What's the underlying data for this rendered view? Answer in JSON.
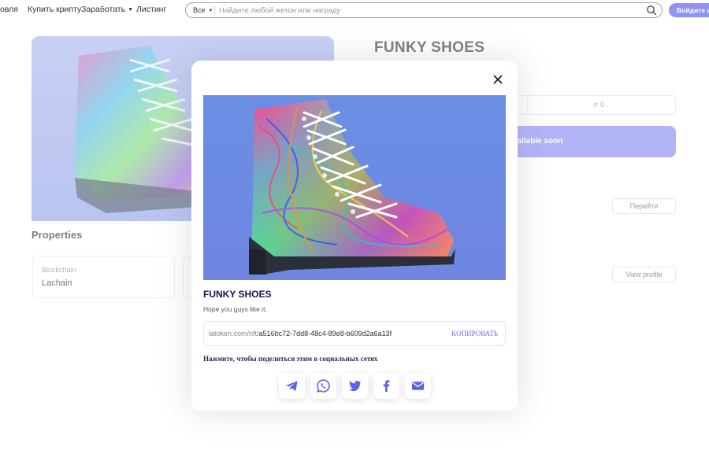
{
  "nav": {
    "items": [
      {
        "label": "овля",
        "caret": false
      },
      {
        "label": "Купить крипту",
        "caret": false
      },
      {
        "label": "Заработать",
        "caret": true
      },
      {
        "label": "Листинг",
        "caret": false
      }
    ]
  },
  "search": {
    "scope": "Все",
    "placeholder": "Найдите любой жетон или награду"
  },
  "login_label": "Войдите или",
  "background": {
    "nft_title": "FUNKY SHOES",
    "share_count": "0",
    "available_label": "vailable soon",
    "goto_label": "Перейти",
    "view_profile_label": "View profile",
    "properties_heading": "Properties",
    "property": {
      "label": "Blockchain",
      "value": "Lachain"
    }
  },
  "modal": {
    "title": "FUNKY SHOES",
    "description": "Hope you guys like it.",
    "link_prefix": "latoken.com/nft/",
    "link_id": "a516bc72-7dd8-48c4-89e8-b609d2a6a13f",
    "copy_label": "КОПИРОВАТЬ",
    "share_hint": "Нажмите, чтобы поделиться этим в социальных сетях",
    "share_buttons": [
      "telegram-icon",
      "whatsapp-icon",
      "twitter-icon",
      "facebook-icon",
      "email-icon"
    ]
  },
  "colors": {
    "accent": "#6d70e6",
    "accent_button": "#8a8df4",
    "title_dark": "#141a4c"
  }
}
